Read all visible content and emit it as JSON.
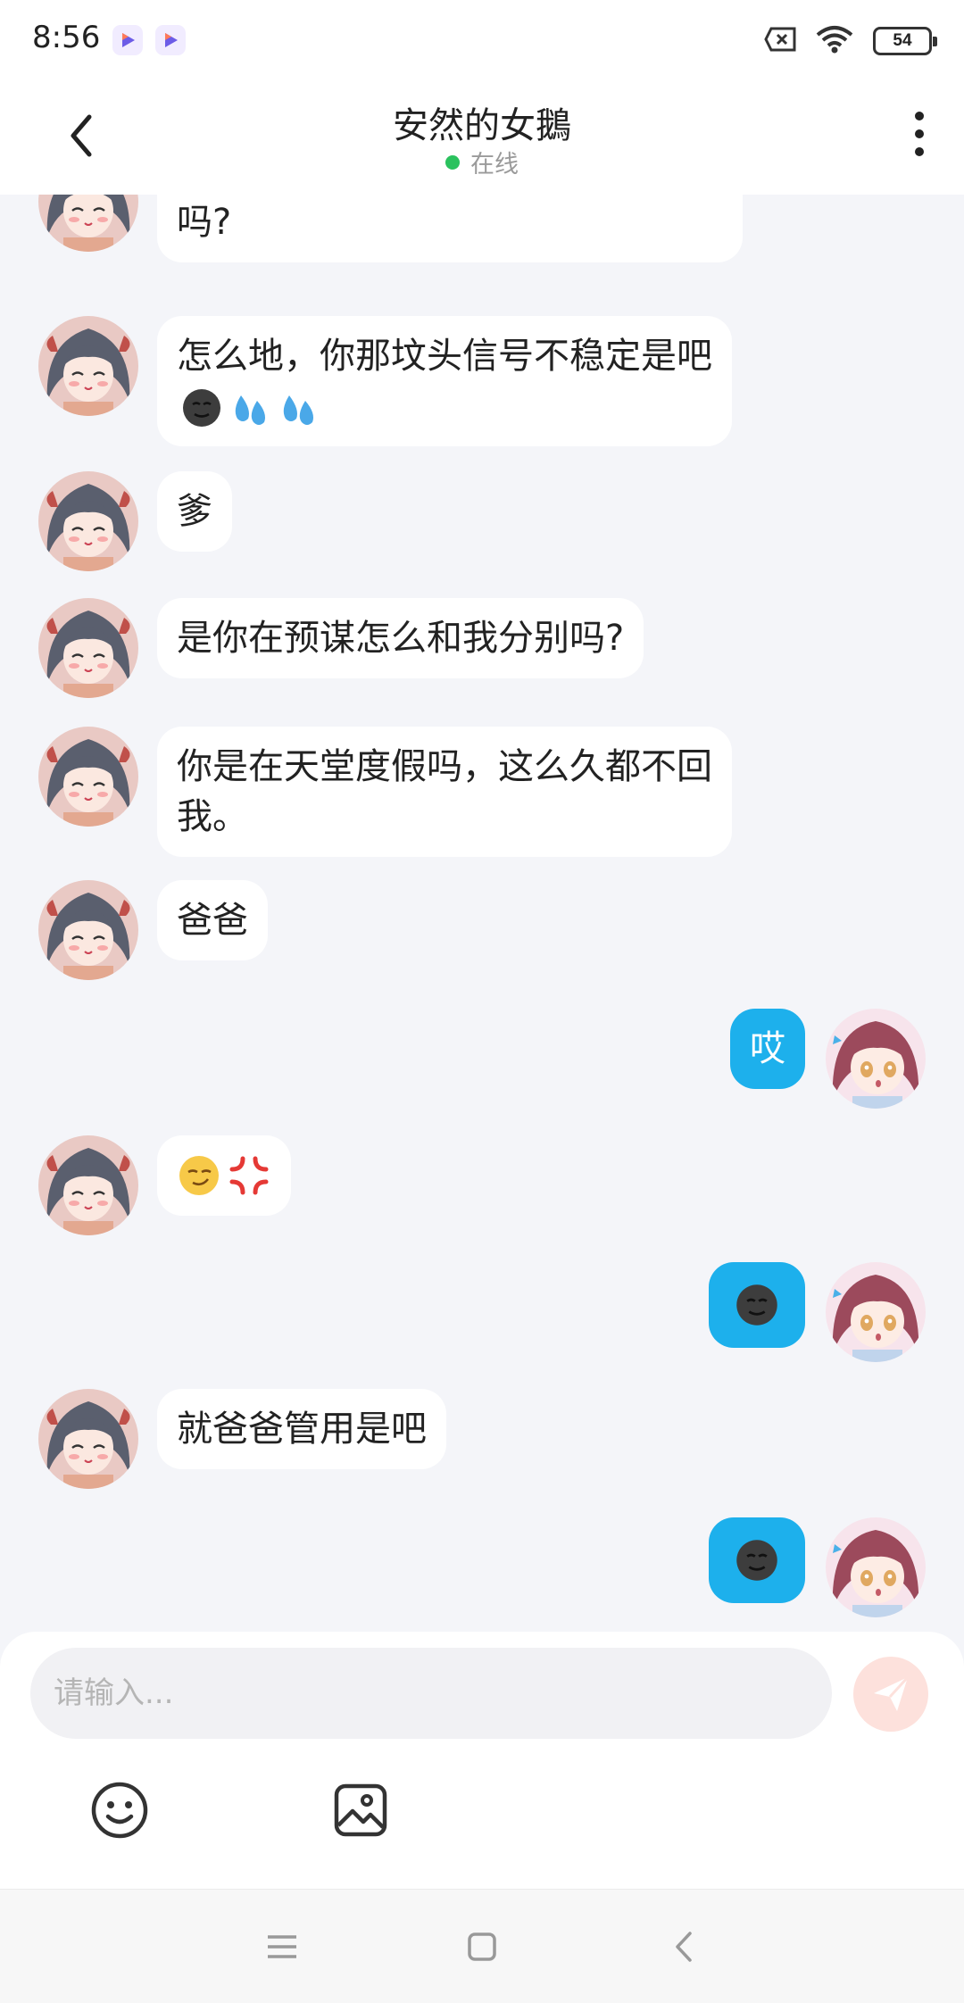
{
  "status_bar": {
    "time": "8:56",
    "battery": "54"
  },
  "header": {
    "title": "安然的女鵝",
    "status": "在线"
  },
  "messages": [
    {
      "side": "in",
      "text": "是地球引力引导你手摁不上屏幕了吗?"
    },
    {
      "side": "in",
      "text": "怎么地，你那坟头信号不稳定是吧",
      "emojis": [
        "dark-face-emoji",
        "sweat-drops-emoji",
        "sweat-drops-emoji"
      ]
    },
    {
      "side": "in",
      "text": "爹"
    },
    {
      "side": "in",
      "text": "是你在预谋怎么和我分别吗?"
    },
    {
      "side": "in",
      "text": "你是在天堂度假吗，这么久都不回我。"
    },
    {
      "side": "in",
      "text": "爸爸"
    },
    {
      "side": "out",
      "text": "哎"
    },
    {
      "side": "in",
      "text": "",
      "emojis": [
        "smirk-emoji",
        "anger-emoji"
      ]
    },
    {
      "side": "out",
      "text": "",
      "emojis": [
        "dark-face-emoji"
      ]
    },
    {
      "side": "in",
      "text": "就爸爸管用是吧"
    },
    {
      "side": "out",
      "text": "",
      "emojis": [
        "dark-face-emoji"
      ]
    }
  ],
  "input": {
    "placeholder": "请输入..."
  },
  "colors": {
    "outgoing_bubble": "#1db0ec",
    "online_dot": "#2bc25e",
    "send_button": "#fde1dc"
  }
}
